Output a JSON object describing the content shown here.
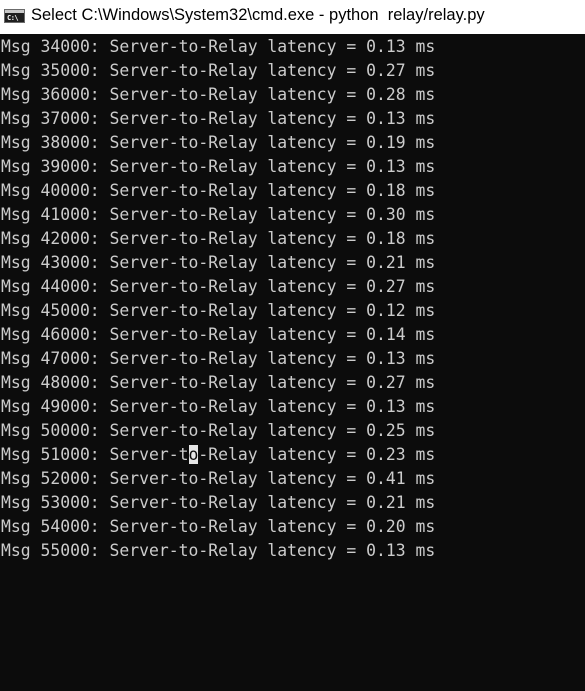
{
  "window": {
    "title": "Select C:\\Windows\\System32\\cmd.exe - python  relay/relay.py",
    "icon": "command-prompt-icon",
    "icon_glyph": "C:\\"
  },
  "console": {
    "lines": [
      "Msg 34000: Server-to-Relay latency = 0.13 ms",
      "Msg 35000: Server-to-Relay latency = 0.27 ms",
      "Msg 36000: Server-to-Relay latency = 0.28 ms",
      "Msg 37000: Server-to-Relay latency = 0.13 ms",
      "Msg 38000: Server-to-Relay latency = 0.19 ms",
      "Msg 39000: Server-to-Relay latency = 0.13 ms",
      "Msg 40000: Server-to-Relay latency = 0.18 ms",
      "Msg 41000: Server-to-Relay latency = 0.30 ms",
      "Msg 42000: Server-to-Relay latency = 0.18 ms",
      "Msg 43000: Server-to-Relay latency = 0.21 ms",
      "Msg 44000: Server-to-Relay latency = 0.27 ms",
      "Msg 45000: Server-to-Relay latency = 0.12 ms",
      "Msg 46000: Server-to-Relay latency = 0.14 ms",
      "Msg 47000: Server-to-Relay latency = 0.13 ms",
      "Msg 48000: Server-to-Relay latency = 0.27 ms",
      "Msg 49000: Server-to-Relay latency = 0.13 ms",
      "Msg 50000: Server-to-Relay latency = 0.25 ms"
    ],
    "cursor_line": {
      "before": "Msg 51000: Server-t",
      "selected": "o",
      "after": "-Relay latency = 0.23 ms"
    },
    "lines_after": [
      "Msg 52000: Server-to-Relay latency = 0.41 ms",
      "Msg 53000: Server-to-Relay latency = 0.21 ms",
      "Msg 54000: Server-to-Relay latency = 0.20 ms",
      "Msg 55000: Server-to-Relay latency = 0.13 ms"
    ]
  },
  "colors": {
    "console_background": "#0c0c0c",
    "console_text": "#cccccc",
    "titlebar_background": "#ffffff",
    "selection_background": "#e6e6e6"
  }
}
